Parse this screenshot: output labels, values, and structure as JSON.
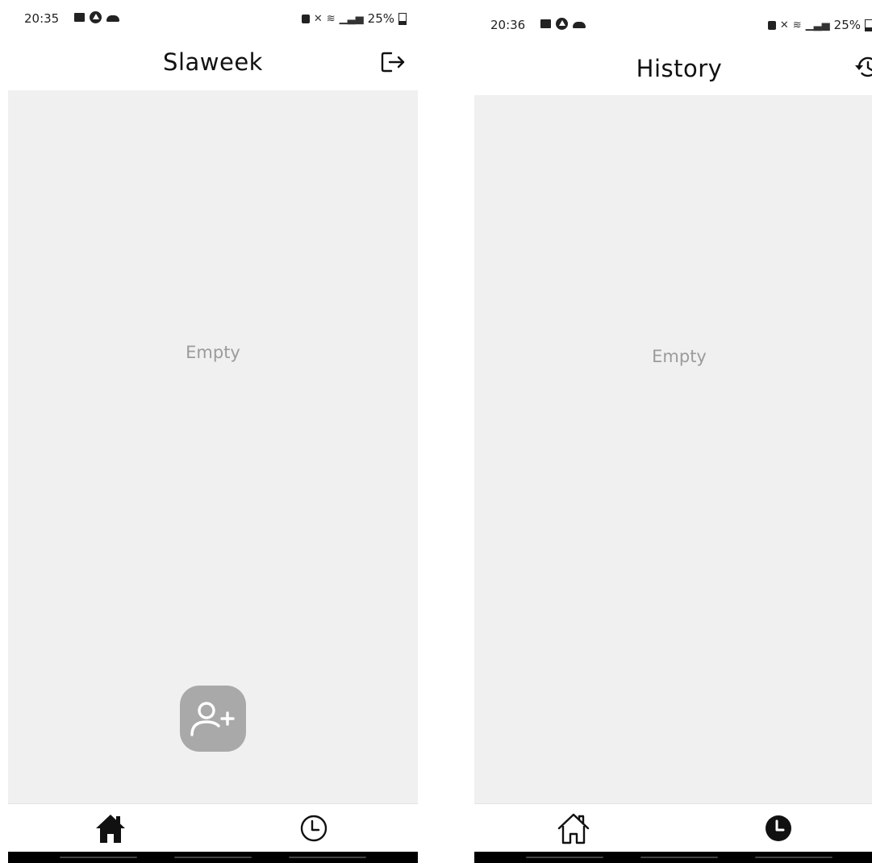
{
  "screens": [
    {
      "id": "home",
      "status": {
        "time": "20:35",
        "battery": "25%"
      },
      "title": "Slaweek",
      "header_action_icon": "logout-icon",
      "empty_text": "Empty",
      "fab_icon": "add-user-icon",
      "tabs": [
        {
          "icon": "home-icon",
          "active": true
        },
        {
          "icon": "clock-icon",
          "active": false
        }
      ]
    },
    {
      "id": "history",
      "status": {
        "time": "20:36",
        "battery": "25%"
      },
      "title": "History",
      "header_action_icon": "history-icon",
      "empty_text": "Empty",
      "tabs": [
        {
          "icon": "home-icon",
          "active": false
        },
        {
          "icon": "clock-icon",
          "active": true
        }
      ]
    }
  ],
  "colors": {
    "content_background": "#f0f0f0",
    "empty_text": "#9b9b9b",
    "fab_background": "#a9a9a9",
    "navigation_bar": "#000000"
  }
}
